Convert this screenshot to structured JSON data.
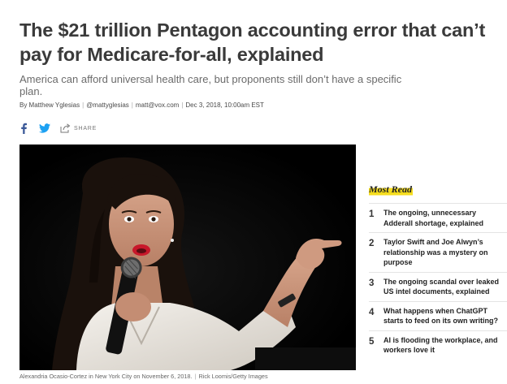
{
  "article": {
    "headline": "The $21 trillion Pentagon accounting error that can’t pay for Medicare-for-all, explained",
    "dek": "America can afford universal health care, but proponents still don’t have a specific plan.",
    "byline": {
      "author": "By Matthew Yglesias",
      "twitter": "@mattyglesias",
      "email": "matt@vox.com",
      "date": "Dec 3, 2018, 10:00am EST"
    },
    "share": {
      "facebook_icon": "facebook-icon",
      "twitter_icon": "twitter-icon",
      "share_icon": "share-arrow-icon",
      "share_label": "SHARE"
    },
    "image": {
      "caption": "Alexandria Ocasio-Cortez in New York City on November 6, 2018.",
      "credit": "Rick Loomis/Getty Images"
    }
  },
  "most_read": {
    "heading": "Most Read",
    "accent_color": "#f6dd1e",
    "items": [
      {
        "number": "1",
        "title": "The ongoing, unnecessary Adderall shortage, explained"
      },
      {
        "number": "2",
        "title": "Taylor Swift and Joe Alwyn’s relationship was a mystery on purpose"
      },
      {
        "number": "3",
        "title": "The ongoing scandal over leaked US intel documents, explained"
      },
      {
        "number": "4",
        "title": "What happens when ChatGPT starts to feed on its own writing?"
      },
      {
        "number": "5",
        "title": "AI is flooding the workplace, and workers love it"
      }
    ]
  }
}
